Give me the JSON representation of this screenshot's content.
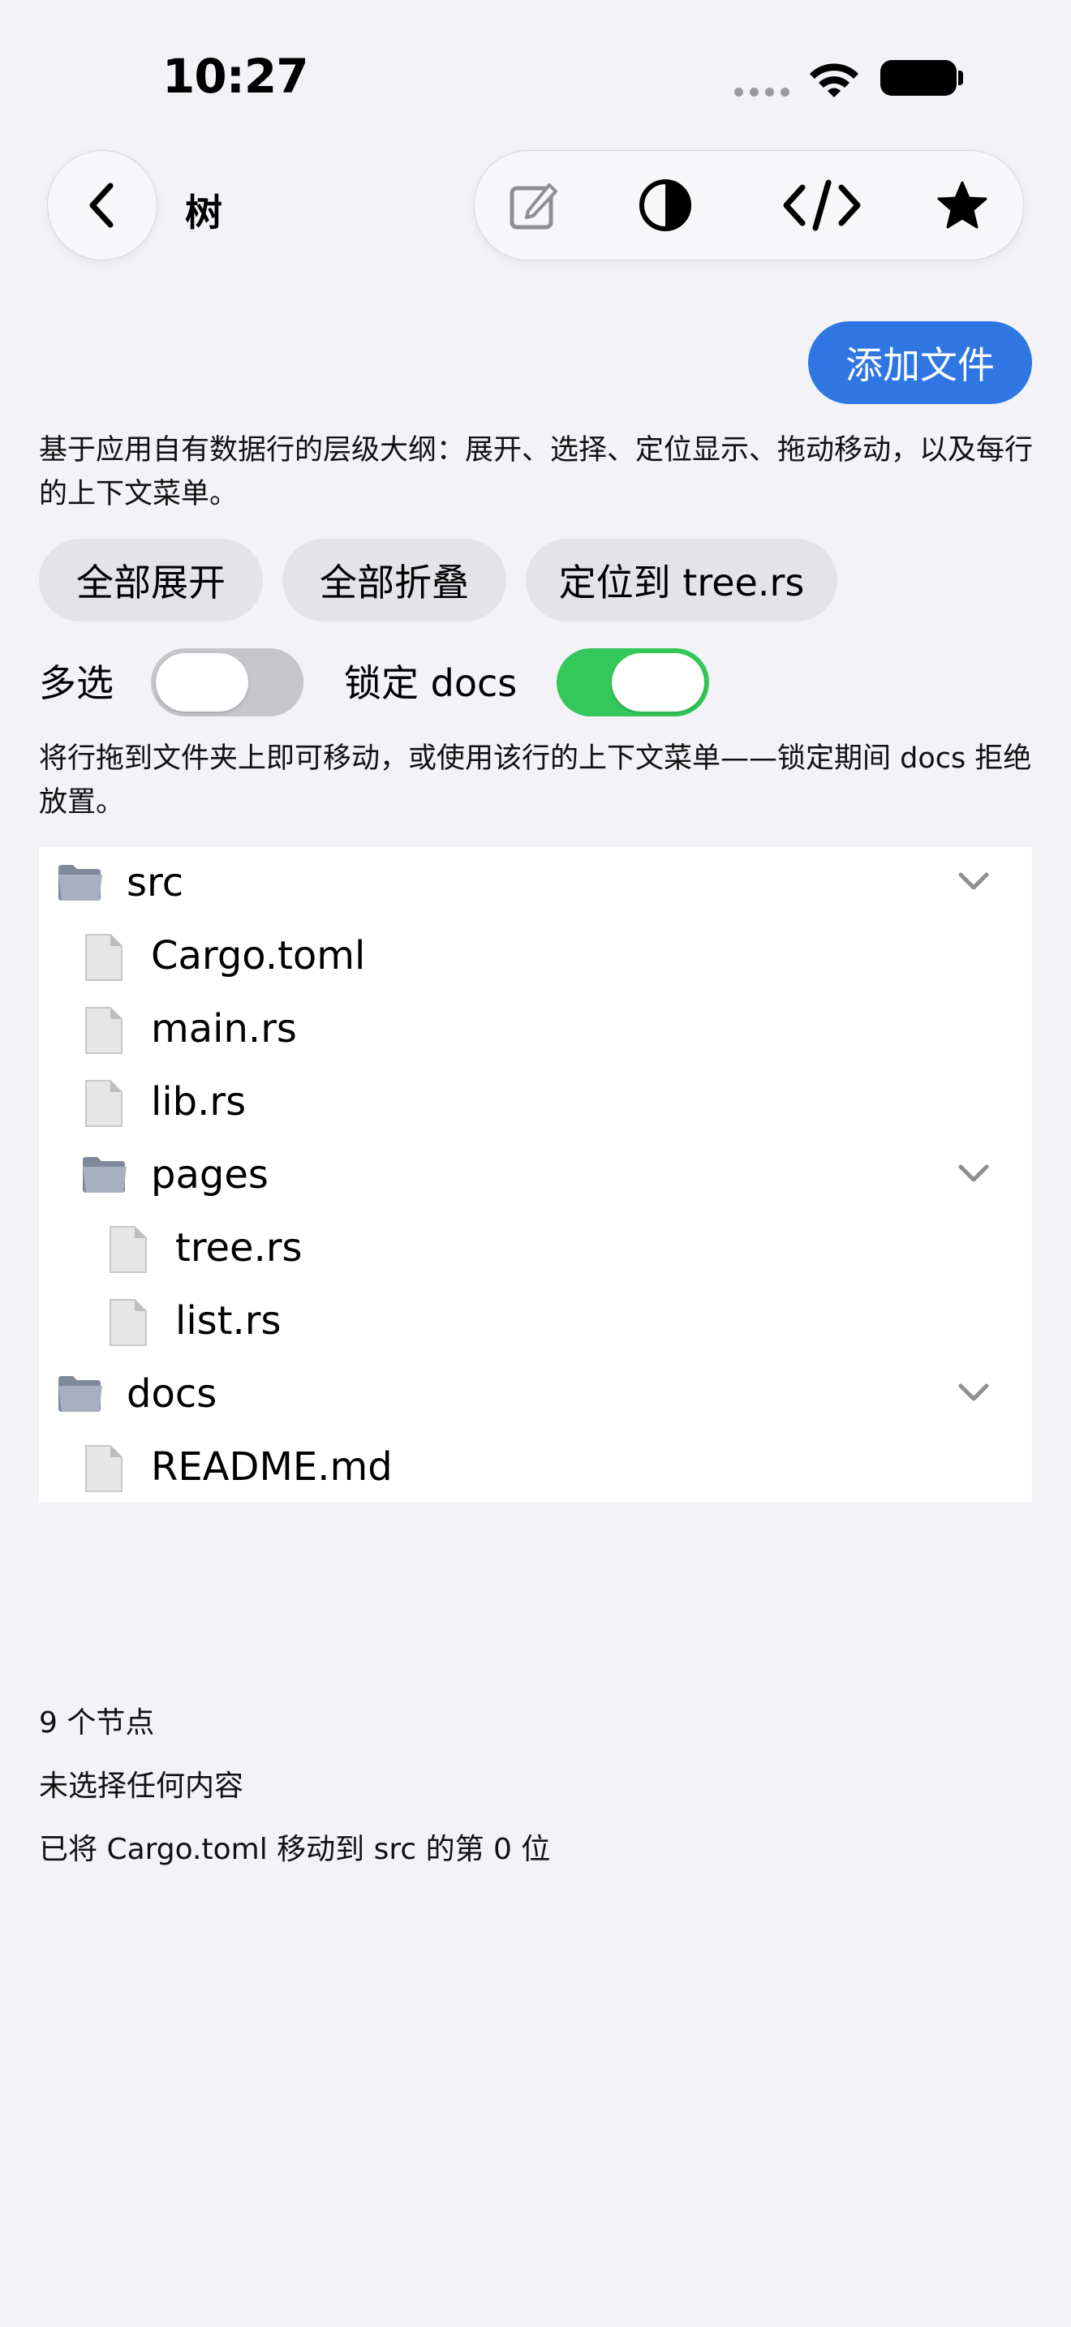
{
  "status": {
    "time": "10:27"
  },
  "nav": {
    "back_icon": "chevron-left-icon",
    "title": "树"
  },
  "toolbar": {
    "icons": [
      "edit-icon",
      "contrast-icon",
      "code-icon",
      "star-icon"
    ]
  },
  "add_file_label": "添加文件",
  "description": "基于应用自有数据行的层级大纲：展开、选择、定位显示、拖动移动，以及每行的上下文菜单。",
  "chips": [
    "全部展开",
    "全部折叠",
    "定位到 tree.rs"
  ],
  "toggles": {
    "multiselect": {
      "label": "多选",
      "on": false
    },
    "lock_docs": {
      "label": "锁定 docs",
      "on": true
    }
  },
  "hint": "将行拖到文件夹上即可移动，或使用该行的上下文菜单——锁定期间 docs 拒绝放置。",
  "tree": [
    {
      "name": "src",
      "kind": "folder",
      "depth": 0,
      "expanded": true
    },
    {
      "name": "Cargo.toml",
      "kind": "file",
      "depth": 1
    },
    {
      "name": "main.rs",
      "kind": "file",
      "depth": 1
    },
    {
      "name": "lib.rs",
      "kind": "file",
      "depth": 1
    },
    {
      "name": "pages",
      "kind": "folder",
      "depth": 1,
      "expanded": true
    },
    {
      "name": "tree.rs",
      "kind": "file",
      "depth": 2
    },
    {
      "name": "list.rs",
      "kind": "file",
      "depth": 2
    },
    {
      "name": "docs",
      "kind": "folder",
      "depth": 0,
      "expanded": true
    },
    {
      "name": "README.md",
      "kind": "file",
      "depth": 1
    }
  ],
  "info": {
    "node_count": "9 个节点",
    "selection": "未选择任何内容",
    "last_move": "已将 Cargo.toml 移动到 src 的第 0 位"
  },
  "colors": {
    "accent": "#2F76E3",
    "toggle_on": "#34C759",
    "toggle_off": "#C5C5CA",
    "background": "#F2F2F7"
  }
}
